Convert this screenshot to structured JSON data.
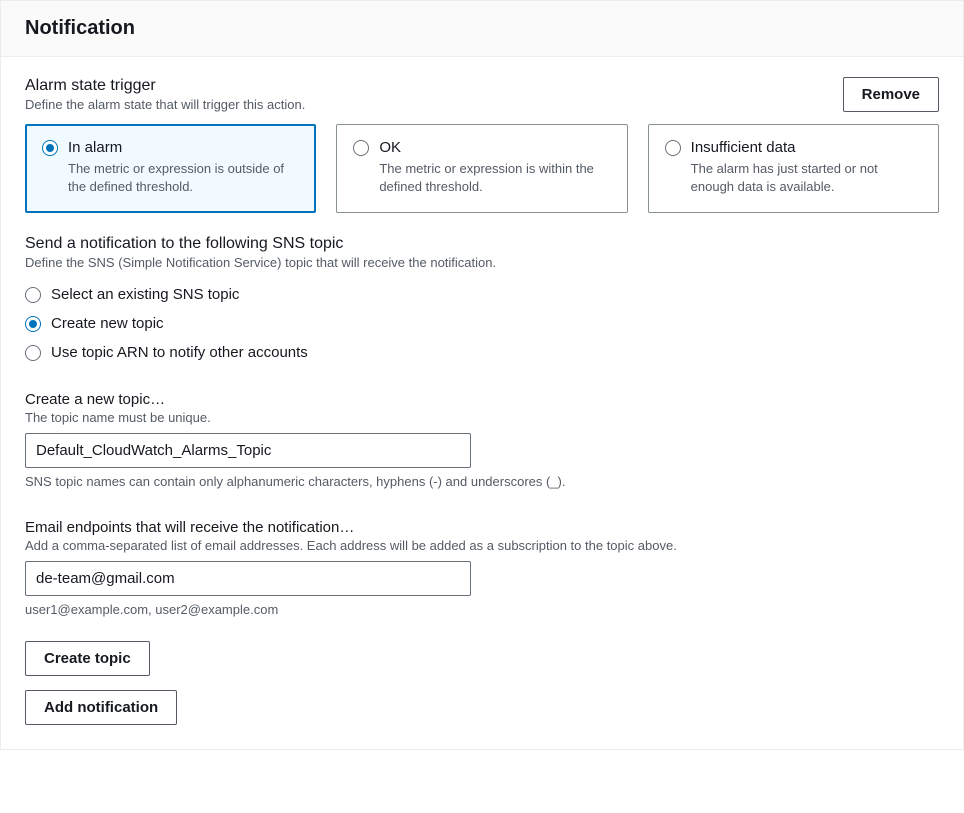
{
  "header": {
    "title": "Notification"
  },
  "alarmState": {
    "title": "Alarm state trigger",
    "desc": "Define the alarm state that will trigger this action.",
    "removeLabel": "Remove",
    "tiles": [
      {
        "title": "In alarm",
        "desc": "The metric or expression is outside of the defined threshold.",
        "selected": true
      },
      {
        "title": "OK",
        "desc": "The metric or expression is within the defined threshold.",
        "selected": false
      },
      {
        "title": "Insufficient data",
        "desc": "The alarm has just started or not enough data is available.",
        "selected": false
      }
    ]
  },
  "snsTopic": {
    "title": "Send a notification to the following SNS topic",
    "desc": "Define the SNS (Simple Notification Service) topic that will receive the notification.",
    "options": [
      {
        "label": "Select an existing SNS topic",
        "selected": false
      },
      {
        "label": "Create new topic",
        "selected": true
      },
      {
        "label": "Use topic ARN to notify other accounts",
        "selected": false
      }
    ]
  },
  "createTopic": {
    "label": "Create a new topic…",
    "hint": "The topic name must be unique.",
    "value": "Default_CloudWatch_Alarms_Topic",
    "sub": "SNS topic names can contain only alphanumeric characters, hyphens (-) and underscores (_)."
  },
  "email": {
    "label": "Email endpoints that will receive the notification…",
    "hint": "Add a comma-separated list of email addresses. Each address will be added as a subscription to the topic above.",
    "value": "de-team@gmail.com",
    "sub": "user1@example.com, user2@example.com"
  },
  "actions": {
    "createTopic": "Create topic",
    "addNotification": "Add notification"
  }
}
